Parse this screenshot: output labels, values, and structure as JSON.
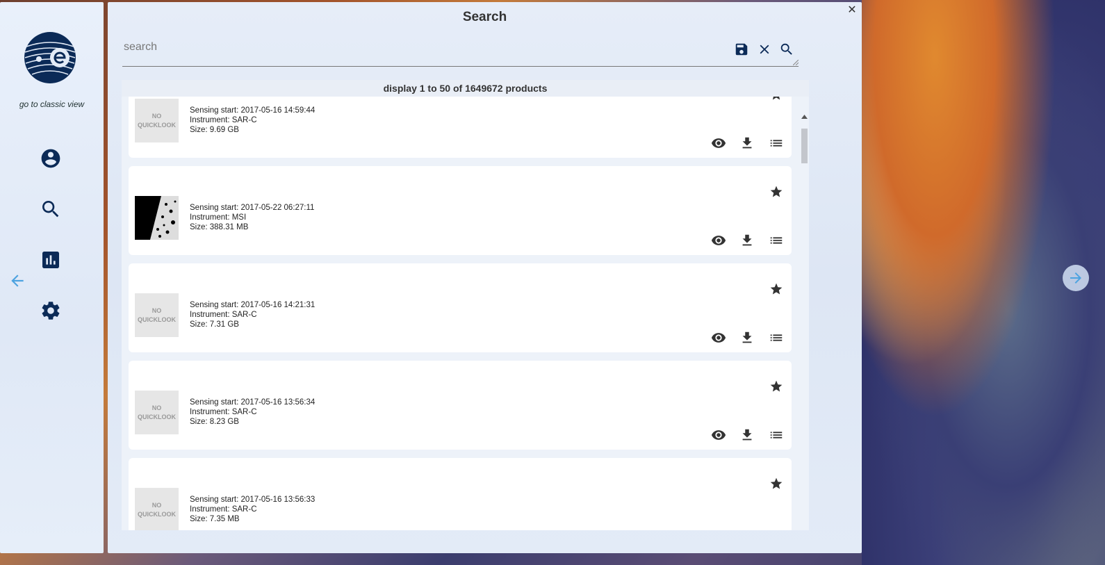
{
  "sidebar": {
    "classic_view_link": "go to classic view",
    "icons": [
      "account-icon",
      "search-icon",
      "chart-icon",
      "settings-icon"
    ]
  },
  "panel": {
    "title": "Search",
    "close_icon": "close-icon"
  },
  "search": {
    "placeholder": "search",
    "value": "",
    "tools": [
      "save-icon",
      "clear-icon",
      "search-icon"
    ]
  },
  "results": {
    "header": "display 1 to 50 of 1649672 products",
    "items": [
      {
        "thumbnail": "NO QUICKLOOK",
        "sensing_start": "Sensing start: 2017-05-16 14:59:44",
        "instrument": "Instrument: SAR-C",
        "size": "Size: 9.69 GB"
      },
      {
        "thumbnail": "",
        "sensing_start": "Sensing start: 2017-05-22 06:27:11",
        "instrument": "Instrument: MSI",
        "size": "Size: 388.31 MB"
      },
      {
        "thumbnail": "NO QUICKLOOK",
        "sensing_start": "Sensing start: 2017-05-16 14:21:31",
        "instrument": "Instrument: SAR-C",
        "size": "Size: 7.31 GB"
      },
      {
        "thumbnail": "NO QUICKLOOK",
        "sensing_start": "Sensing start: 2017-05-16 13:56:34",
        "instrument": "Instrument: SAR-C",
        "size": "Size: 8.23 GB"
      },
      {
        "thumbnail": "NO QUICKLOOK",
        "sensing_start": "Sensing start: 2017-05-16 13:56:33",
        "instrument": "Instrument: SAR-C",
        "size": "Size: 7.35 MB"
      }
    ],
    "item_actions": [
      "star-icon",
      "eye-icon",
      "download-icon",
      "list-icon"
    ]
  },
  "navigation": {
    "prev_icon": "arrow-left-icon",
    "next_icon": "arrow-right-icon"
  },
  "colors": {
    "brand_dark": "#0b2a57",
    "accent_blue": "#4da3e0",
    "panel_bg": "#e3ebf7",
    "card_bg": "#ffffff"
  }
}
